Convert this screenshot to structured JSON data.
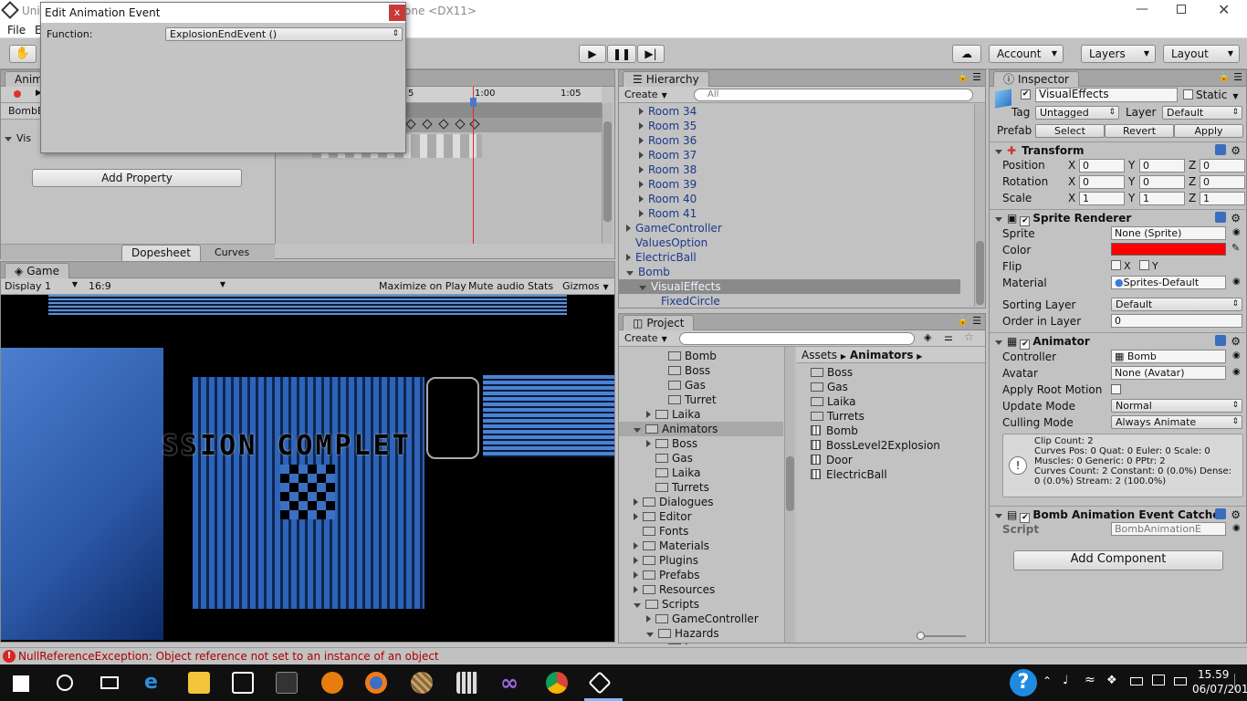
{
  "window": {
    "title": "Unity ... .unity - Dungeon - PC, Mac & Linux Standalone <DX11>",
    "title_visible_left": "Unit",
    "title_visible_right": "one <DX11>",
    "controls": [
      "minimize-icon",
      "restore-icon",
      "close-icon"
    ]
  },
  "menu": {
    "file": "File",
    "edit": "E"
  },
  "toolbar": {
    "account": "Account",
    "layers": "Layers",
    "layout": "Layout"
  },
  "event_dialog": {
    "title": "Edit Animation Event",
    "function_label": "Function:",
    "function_value": "ExplosionEndEvent ()",
    "close": "x"
  },
  "animation": {
    "tab": "Anim",
    "clip": "BombE",
    "property": "Vis",
    "add_property": "Add Property",
    "dopesheet": "Dopesheet",
    "curves": "Curves",
    "times": [
      "5",
      "1:00",
      "1:05"
    ]
  },
  "game": {
    "tab": "Game",
    "display": "Display 1",
    "aspect": "16:9",
    "maximize": "Maximize on Play",
    "mute": "Mute audio",
    "stats": "Stats",
    "gizmos": "Gizmos",
    "overlay_text": "SSION COMPLET"
  },
  "hierarchy": {
    "tab": "Hierarchy",
    "create": "Create",
    "search": "All",
    "rows": [
      {
        "label": "Room 34",
        "indent": 1,
        "expand": "closed",
        "selected": false
      },
      {
        "label": "Room 35",
        "indent": 1,
        "expand": "closed",
        "selected": false
      },
      {
        "label": "Room 36",
        "indent": 1,
        "expand": "closed",
        "selected": false
      },
      {
        "label": "Room 37",
        "indent": 1,
        "expand": "closed",
        "selected": false
      },
      {
        "label": "Room 38",
        "indent": 1,
        "expand": "closed",
        "selected": false
      },
      {
        "label": "Room 39",
        "indent": 1,
        "expand": "closed",
        "selected": false
      },
      {
        "label": "Room 40",
        "indent": 1,
        "expand": "closed",
        "selected": false
      },
      {
        "label": "Room 41",
        "indent": 1,
        "expand": "closed",
        "selected": false
      },
      {
        "label": "GameController",
        "indent": 0,
        "expand": "closed",
        "selected": false
      },
      {
        "label": "ValuesOption",
        "indent": 0,
        "expand": "none",
        "selected": false
      },
      {
        "label": "ElectricBall",
        "indent": 0,
        "expand": "closed",
        "selected": false
      },
      {
        "label": "Bomb",
        "indent": 0,
        "expand": "open",
        "selected": false
      },
      {
        "label": "VisualEffects",
        "indent": 1,
        "expand": "open",
        "selected": true
      },
      {
        "label": "FixedCircle",
        "indent": 2,
        "expand": "none",
        "selected": false
      }
    ]
  },
  "project": {
    "tab": "Project",
    "create": "Create",
    "tree": [
      {
        "label": "Bomb",
        "indent": 2,
        "expand": "none"
      },
      {
        "label": "Boss",
        "indent": 2,
        "expand": "none"
      },
      {
        "label": "Gas",
        "indent": 2,
        "expand": "none"
      },
      {
        "label": "Turret",
        "indent": 2,
        "expand": "none"
      },
      {
        "label": "Laika",
        "indent": 1,
        "expand": "closed"
      },
      {
        "label": "Animators",
        "indent": 0,
        "expand": "open",
        "selected": true
      },
      {
        "label": "Boss",
        "indent": 1,
        "expand": "closed"
      },
      {
        "label": "Gas",
        "indent": 1,
        "expand": "none"
      },
      {
        "label": "Laika",
        "indent": 1,
        "expand": "none"
      },
      {
        "label": "Turrets",
        "indent": 1,
        "expand": "none"
      },
      {
        "label": "Dialogues",
        "indent": 0,
        "expand": "closed"
      },
      {
        "label": "Editor",
        "indent": 0,
        "expand": "closed"
      },
      {
        "label": "Fonts",
        "indent": 0,
        "expand": "none"
      },
      {
        "label": "Materials",
        "indent": 0,
        "expand": "closed"
      },
      {
        "label": "Plugins",
        "indent": 0,
        "expand": "closed"
      },
      {
        "label": "Prefabs",
        "indent": 0,
        "expand": "closed"
      },
      {
        "label": "Resources",
        "indent": 0,
        "expand": "closed"
      },
      {
        "label": "Scripts",
        "indent": 0,
        "expand": "open"
      },
      {
        "label": "GameController",
        "indent": 1,
        "expand": "closed"
      },
      {
        "label": "Hazards",
        "indent": 1,
        "expand": "open"
      },
      {
        "label": "Lasers",
        "indent": 2,
        "expand": "none"
      }
    ],
    "breadcrumb": [
      "Assets",
      "Animators"
    ],
    "assets": [
      {
        "label": "Boss",
        "type": "folder"
      },
      {
        "label": "Gas",
        "type": "folder"
      },
      {
        "label": "Laika",
        "type": "folder"
      },
      {
        "label": "Turrets",
        "type": "folder"
      },
      {
        "label": "Bomb",
        "type": "animator"
      },
      {
        "label": "BossLevel2Explosion",
        "type": "animator"
      },
      {
        "label": "Door",
        "type": "animator"
      },
      {
        "label": "ElectricBall",
        "type": "animator"
      }
    ]
  },
  "inspector": {
    "tab": "Inspector",
    "name": "VisualEffects",
    "static": "Static",
    "tag_label": "Tag",
    "tag": "Untagged",
    "layer_label": "Layer",
    "layer": "Default",
    "prefab_label": "Prefab",
    "select": "Select",
    "revert": "Revert",
    "apply": "Apply",
    "transform": {
      "title": "Transform",
      "position": "Position",
      "rotation": "Rotation",
      "scale": "Scale",
      "x": "X",
      "y": "Y",
      "z": "Z",
      "pos": [
        "0",
        "0",
        "0"
      ],
      "rot": [
        "0",
        "0",
        "0"
      ],
      "scl": [
        "1",
        "1",
        "1"
      ]
    },
    "sprite_renderer": {
      "title": "Sprite Renderer",
      "sprite_label": "Sprite",
      "sprite": "None (Sprite)",
      "color_label": "Color",
      "color": "#ff0000",
      "flip_label": "Flip",
      "flip_x": "X",
      "flip_y": "Y",
      "material_label": "Material",
      "material": "Sprites-Default",
      "sorting_label": "Sorting Layer",
      "sorting": "Default",
      "order_label": "Order in Layer",
      "order": "0"
    },
    "animator": {
      "title": "Animator",
      "controller_label": "Controller",
      "controller": "Bomb",
      "avatar_label": "Avatar",
      "avatar": "None (Avatar)",
      "root_label": "Apply Root Motion",
      "update_label": "Update Mode",
      "update": "Normal",
      "culling_label": "Culling Mode",
      "culling": "Always Animate",
      "info": [
        "Clip Count: 2",
        "Curves Pos: 0 Quat: 0 Euler: 0 Scale: 0",
        "Muscles: 0 Generic: 0 PPtr: 2",
        "Curves Count: 2 Constant: 0 (0.0%) Dense:",
        "0 (0.0%) Stream: 2 (100.0%)"
      ]
    },
    "script_comp": {
      "title": "Bomb Animation Event Catche",
      "script_label": "Script",
      "script": "BombAnimationE"
    },
    "add_component": "Add Component"
  },
  "console": {
    "error": "NullReferenceException: Object reference not set to an instance of an object"
  },
  "taskbar": {
    "time": "15.59",
    "date": "06/07/2016",
    "help": "?"
  }
}
